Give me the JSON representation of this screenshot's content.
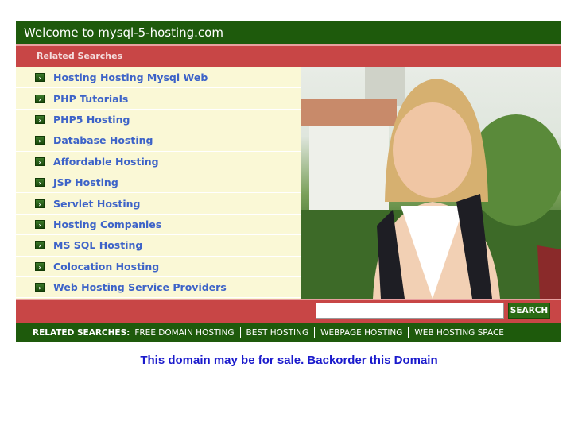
{
  "header": {
    "title": "Welcome to mysql-5-hosting.com"
  },
  "related": {
    "heading": "Related Searches",
    "items": [
      {
        "label": "Hosting Hosting Mysql Web"
      },
      {
        "label": "PHP Tutorials"
      },
      {
        "label": "PHP5 Hosting"
      },
      {
        "label": "Database Hosting"
      },
      {
        "label": "Affordable Hosting"
      },
      {
        "label": "JSP Hosting"
      },
      {
        "label": "Servlet Hosting"
      },
      {
        "label": "Hosting Companies"
      },
      {
        "label": "MS SQL Hosting"
      },
      {
        "label": "Colocation Hosting"
      },
      {
        "label": "Web Hosting Service Providers"
      }
    ],
    "bullet_icon": "arrow-right-icon"
  },
  "photo": {
    "description": "smiling young woman with backpack in front of building"
  },
  "search": {
    "value": "",
    "button_label": "SEARCH"
  },
  "bottom_bar": {
    "label": "RELATED SEARCHES:",
    "items": [
      "FREE DOMAIN HOSTING",
      "BEST HOSTING",
      "WEBPAGE HOSTING",
      "WEB HOSTING SPACE"
    ]
  },
  "sale": {
    "text": "This domain may be for sale.",
    "link": "Backorder this Domain"
  },
  "colors": {
    "green": "#1e5a0c",
    "red": "#c84646",
    "cream": "#faf8d6",
    "link": "#3d63c8"
  }
}
